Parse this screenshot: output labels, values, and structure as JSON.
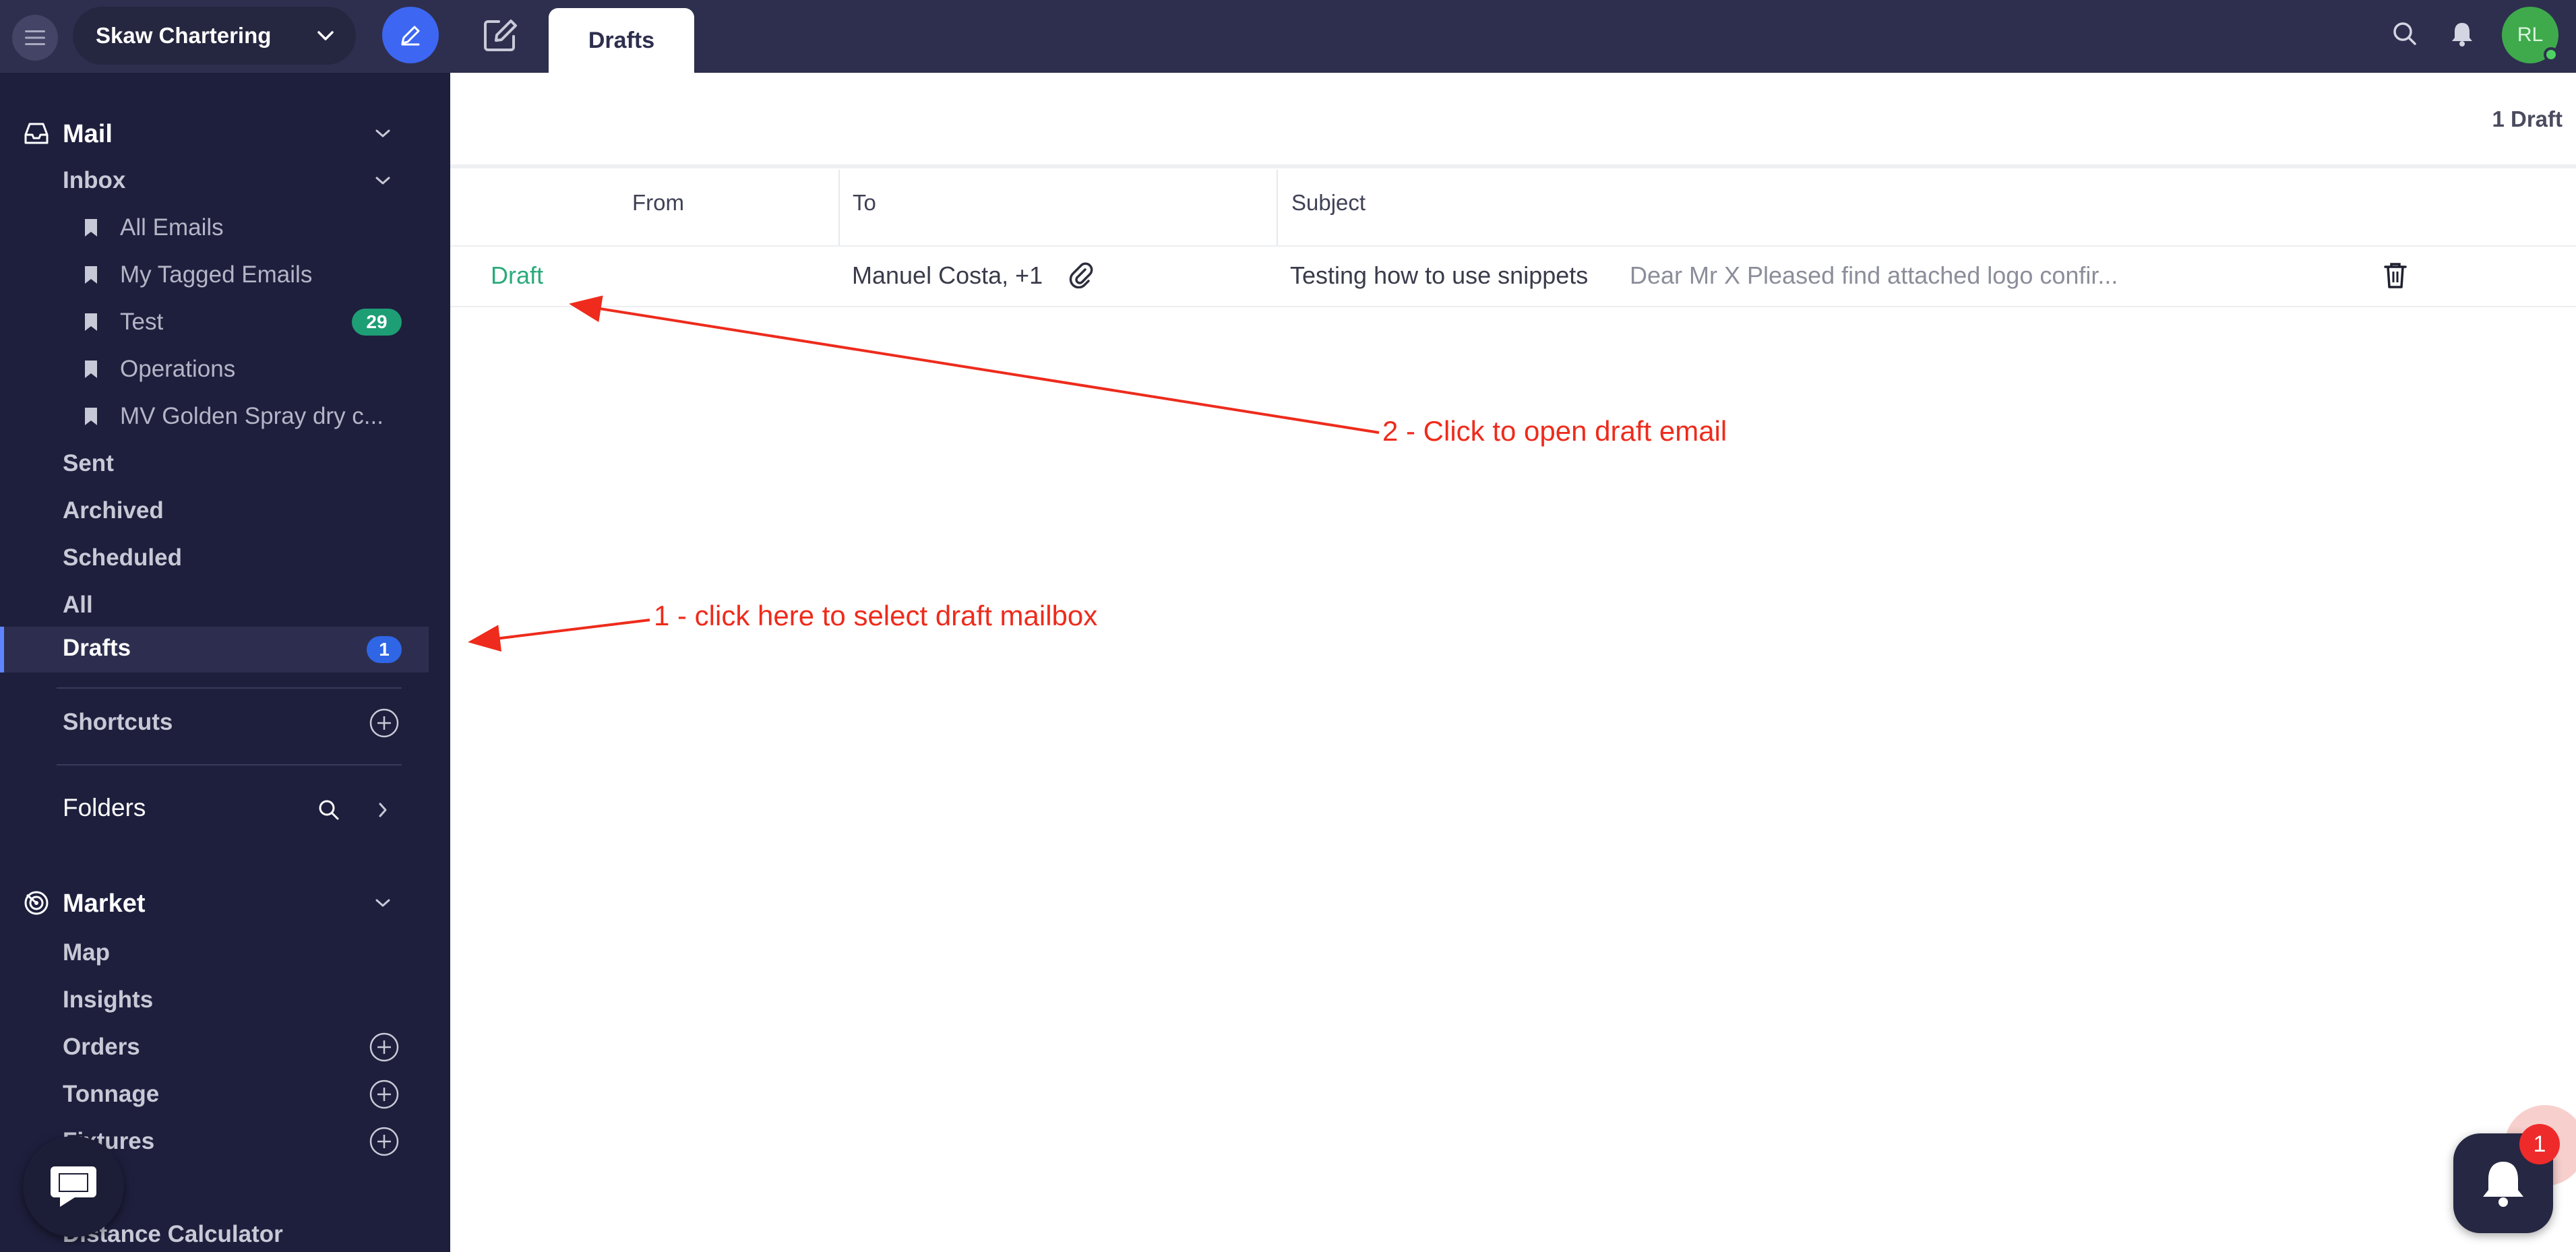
{
  "topbar": {
    "workspace": "Skaw Chartering",
    "active_tab": "Drafts",
    "avatar_initials": "RL"
  },
  "sidebar": {
    "mail": {
      "title": "Mail",
      "inbox": {
        "label": "Inbox",
        "items": [
          {
            "label": "All Emails"
          },
          {
            "label": "My Tagged Emails"
          },
          {
            "label": "Test",
            "badge": "29"
          },
          {
            "label": "Operations"
          },
          {
            "label": "MV Golden Spray dry c..."
          }
        ]
      },
      "sent": "Sent",
      "archived": "Archived",
      "scheduled": "Scheduled",
      "all": "All",
      "drafts": {
        "label": "Drafts",
        "badge": "1"
      },
      "shortcuts": "Shortcuts",
      "folders": "Folders"
    },
    "market": {
      "title": "Market",
      "items": [
        {
          "label": "Map"
        },
        {
          "label": "Insights"
        },
        {
          "label": "Orders"
        },
        {
          "label": "Tonnage"
        },
        {
          "label": "Fixtures"
        },
        {
          "label": "Distance Calculator"
        }
      ]
    }
  },
  "main": {
    "count_label": "1 Draft",
    "columns": {
      "from": "From",
      "to": "To",
      "subject": "Subject"
    },
    "rows": [
      {
        "from": "Draft",
        "to": "Manuel Costa, +1",
        "subject": "Testing how to use snippets",
        "preview": "Dear Mr X Pleased find attached logo confir..."
      }
    ]
  },
  "annotations": {
    "step1": "1 - click here to select draft mailbox",
    "step2": "2 - Click to open draft email",
    "color": "#ee2b1c"
  },
  "notifications": {
    "count": "1"
  },
  "colors": {
    "topbar": "#2e2f4e",
    "sidebar": "#1e1f3d",
    "accent_blue": "#3d67f2",
    "draft_green": "#2bab7c",
    "badge_green": "#1e9e74",
    "badge_blue": "#2f66e6"
  }
}
